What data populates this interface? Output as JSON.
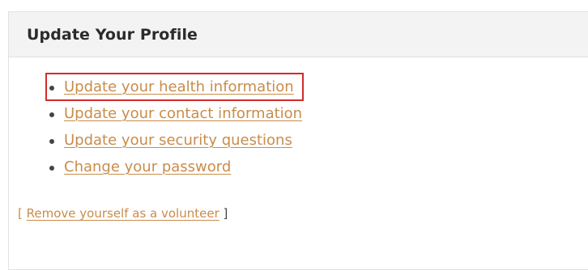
{
  "panel": {
    "title": "Update Your Profile"
  },
  "links": [
    {
      "label": "Update your health information",
      "highlighted": true
    },
    {
      "label": "Update your contact information",
      "highlighted": false
    },
    {
      "label": "Update your security questions",
      "highlighted": false
    },
    {
      "label": "Change your password",
      "highlighted": false
    }
  ],
  "footer": {
    "open_bracket": "[",
    "remove_label": "Remove yourself as a volunteer",
    "close_bracket": "]"
  },
  "colors": {
    "link": "#c98c4a",
    "highlight_box": "#d12b2b",
    "header_bg": "#f3f3f3",
    "title": "#2b2b2b"
  }
}
